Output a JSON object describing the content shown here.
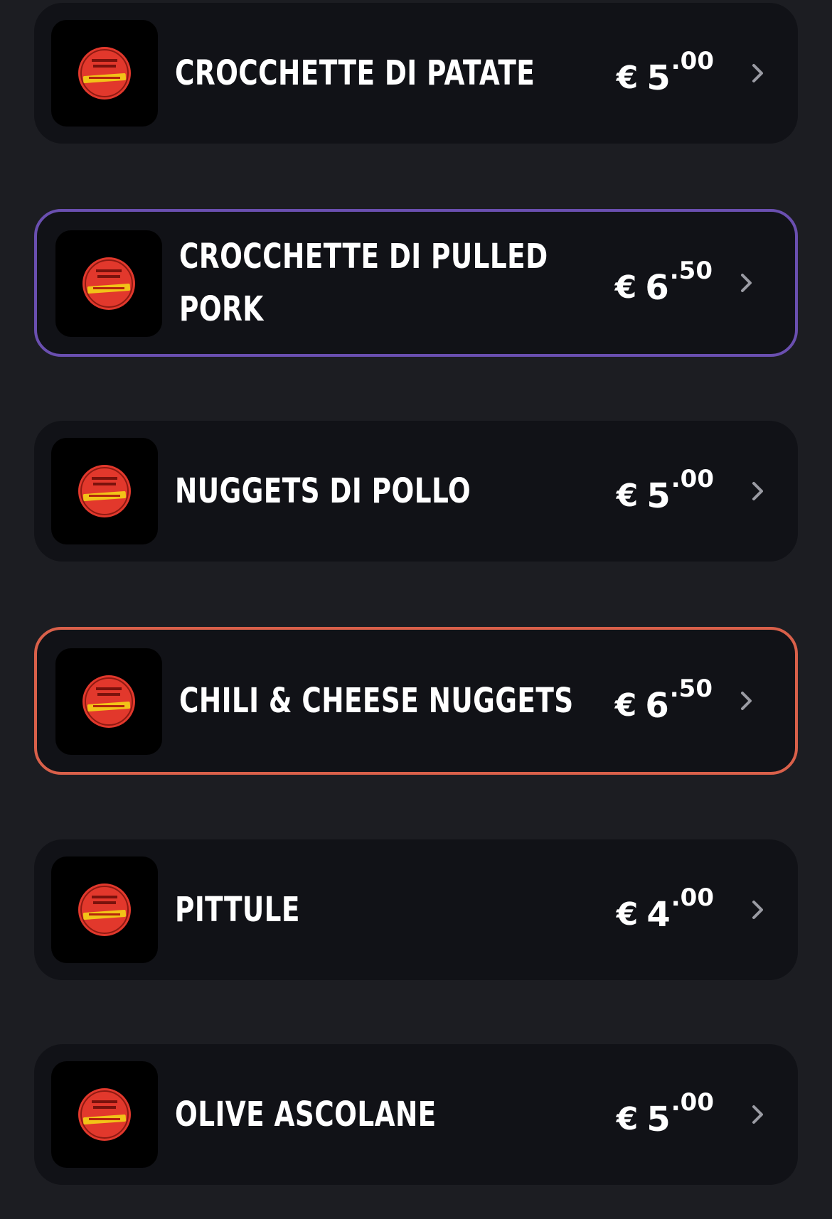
{
  "colors": {
    "background": "#1c1d22",
    "card": "#111217",
    "thumb": "#000000",
    "text": "#ffffff",
    "chevron": "#9a9ba3",
    "logo_red": "#e2382c",
    "logo_yellow": "#f2c318"
  },
  "icons": {
    "logo": "habitus-logo-icon",
    "chevron": "chevron-right-icon"
  },
  "items": [
    {
      "name": "CROCCHETTE DI PATATE",
      "currency": "€",
      "price_whole": "5",
      "price_decimal": ".00",
      "accent": null
    },
    {
      "name": "CROCCHETTE DI PULLED PORK",
      "currency": "€",
      "price_whole": "6",
      "price_decimal": ".50",
      "accent": "#6a4fb0"
    },
    {
      "name": "NUGGETS DI POLLO",
      "currency": "€",
      "price_whole": "5",
      "price_decimal": ".00",
      "accent": null
    },
    {
      "name": "CHILI & CHEESE NUGGETS",
      "currency": "€",
      "price_whole": "6",
      "price_decimal": ".50",
      "accent": "#d9604a"
    },
    {
      "name": "PITTULE",
      "currency": "€",
      "price_whole": "4",
      "price_decimal": ".00",
      "accent": null
    },
    {
      "name": "OLIVE ASCOLANE",
      "currency": "€",
      "price_whole": "5",
      "price_decimal": ".00",
      "accent": null
    }
  ]
}
